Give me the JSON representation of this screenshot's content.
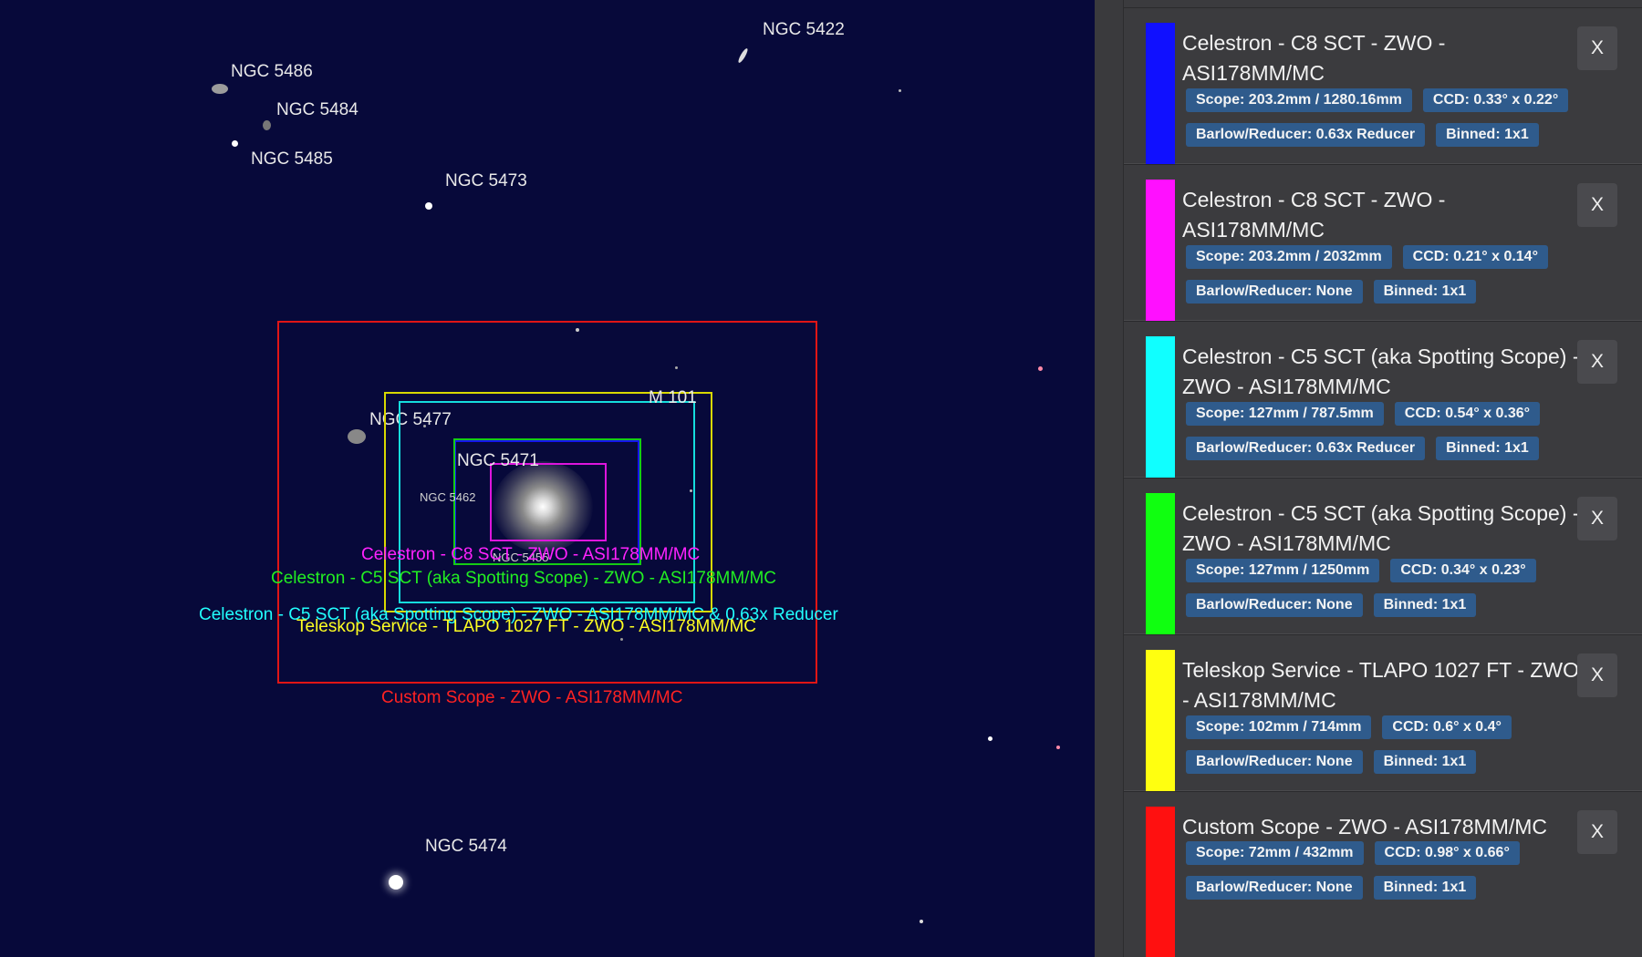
{
  "sky": {
    "objects": [
      {
        "id": "ngc5422",
        "label": "NGC 5422"
      },
      {
        "id": "ngc5486",
        "label": "NGC 5486"
      },
      {
        "id": "ngc5484",
        "label": "NGC 5484"
      },
      {
        "id": "ngc5485",
        "label": "NGC 5485"
      },
      {
        "id": "ngc5473",
        "label": "NGC 5473"
      },
      {
        "id": "m101",
        "label": "M 101"
      },
      {
        "id": "ngc5477",
        "label": "NGC 5477"
      },
      {
        "id": "ngc5471",
        "label": "NGC 5471"
      },
      {
        "id": "ngc5462",
        "label": "NGC 5462"
      },
      {
        "id": "ngc5455",
        "label": "NGC 5455"
      },
      {
        "id": "ngc5474",
        "label": "NGC 5474"
      }
    ],
    "fov_labels": [
      {
        "text": "Celestron - C8 SCT - ZWO - ASI178MM/MC",
        "color": "#ff22ff"
      },
      {
        "text": "Celestron - C5 SCT (aka Spotting Scope) - ZWO - ASI178MM/MC",
        "color": "#22ff22"
      },
      {
        "text": "Celestron - C5 SCT (aka Spotting Scope) - ZWO - ASI178MM/MC & 0.63x Reducer",
        "color": "#22ffff"
      },
      {
        "text": "Teleskop Service - TLAPO 1027 FT - ZWO - ASI178MM/MC",
        "color": "#ffff22"
      },
      {
        "text": "Custom Scope - ZWO - ASI178MM/MC",
        "color": "#ff2222"
      }
    ]
  },
  "panel": {
    "close_label": "X",
    "items": [
      {
        "title": "Celestron - C8 SCT - ZWO - ASI178MM/MC",
        "color": "#1010ff",
        "scope": "Scope: 203.2mm / 1280.16mm",
        "ccd": "CCD: 0.33° x 0.22°",
        "barlow": "Barlow/Reducer: 0.63x Reducer",
        "binned": "Binned: 1x1"
      },
      {
        "title": "Celestron - C8 SCT - ZWO - ASI178MM/MC",
        "color": "#ff10ff",
        "scope": "Scope: 203.2mm / 2032mm",
        "ccd": "CCD: 0.21° x 0.14°",
        "barlow": "Barlow/Reducer: None",
        "binned": "Binned: 1x1"
      },
      {
        "title": "Celestron - C5 SCT (aka Spotting Scope) - ZWO - ASI178MM/MC",
        "color": "#10ffff",
        "scope": "Scope: 127mm / 787.5mm",
        "ccd": "CCD: 0.54° x 0.36°",
        "barlow": "Barlow/Reducer: 0.63x Reducer",
        "binned": "Binned: 1x1"
      },
      {
        "title": "Celestron - C5 SCT (aka Spotting Scope) - ZWO - ASI178MM/MC",
        "color": "#10ff10",
        "scope": "Scope: 127mm / 1250mm",
        "ccd": "CCD: 0.34° x 0.23°",
        "barlow": "Barlow/Reducer: None",
        "binned": "Binned: 1x1"
      },
      {
        "title": "Teleskop Service - TLAPO 1027 FT - ZWO - ASI178MM/MC",
        "color": "#ffff10",
        "scope": "Scope: 102mm / 714mm",
        "ccd": "CCD: 0.6° x 0.4°",
        "barlow": "Barlow/Reducer: None",
        "binned": "Binned: 1x1"
      },
      {
        "title": "Custom Scope - ZWO - ASI178MM/MC",
        "color": "#ff1010",
        "scope": "Scope: 72mm / 432mm",
        "ccd": "CCD: 0.98° x 0.66°",
        "barlow": "Barlow/Reducer: None",
        "binned": "Binned: 1x1"
      }
    ]
  }
}
